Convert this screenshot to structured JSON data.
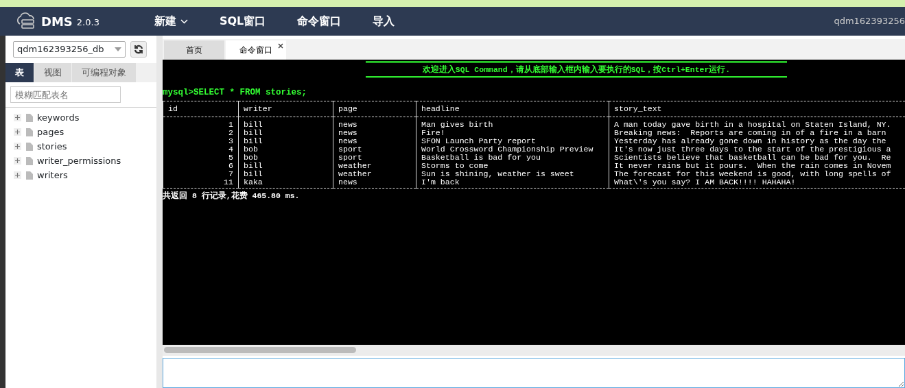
{
  "navbar": {
    "logo": "DMS",
    "version": "2.0.3",
    "menu": [
      {
        "label": "新建",
        "dropdown": true
      },
      {
        "label": "SQL窗口",
        "dropdown": false
      },
      {
        "label": "命令窗口",
        "dropdown": false
      },
      {
        "label": "导入",
        "dropdown": false
      }
    ],
    "user": "qdm162393256"
  },
  "sidebar": {
    "database": "qdm162393256_db",
    "tabs": [
      {
        "label": "表",
        "selected": true
      },
      {
        "label": "视图",
        "selected": false
      },
      {
        "label": "可编程对象",
        "selected": false
      }
    ],
    "search": {
      "placeholder": "模糊匹配表名"
    },
    "tables": [
      {
        "name": "keywords",
        "expanded": false
      },
      {
        "name": "pages",
        "expanded": false
      },
      {
        "name": "stories",
        "expanded": false
      },
      {
        "name": "writer_permissions",
        "expanded": false
      },
      {
        "name": "writers",
        "expanded": false
      }
    ]
  },
  "editor_tabs": [
    {
      "label": "首页",
      "selected": false,
      "closable": false
    },
    {
      "label": "命令窗口",
      "selected": true,
      "closable": true
    }
  ],
  "console": {
    "banner": "欢迎进入SQL Command，请从底部输入框内输入要执行的SQL，按Ctrl+Enter运行.",
    "command": "mysql>SELECT * FROM stories;",
    "table": {
      "columns": [
        "id",
        "writer",
        "page",
        "headline",
        "story_text"
      ],
      "rows": [
        [
          "1",
          "bill",
          "news",
          "Man gives birth",
          "A man today gave birth in a hospital on Staten Island, NY."
        ],
        [
          "2",
          "bill",
          "news",
          "Fire!",
          "Breaking news:  Reports are coming in of a fire in a barn"
        ],
        [
          "3",
          "bill",
          "news",
          "SFON Launch Party report",
          "Yesterday has already gone down in history as the day the"
        ],
        [
          "4",
          "bob",
          "sport",
          "World Crossword Championship Preview",
          "It's now just three days to the start of the prestigious a"
        ],
        [
          "5",
          "bob",
          "sport",
          "Basketball is bad for you",
          "Scientists believe that basketball can be bad for you.  Re"
        ],
        [
          "6",
          "bill",
          "weather",
          "Storms to come",
          "It never rains but it pours.  When the rain comes in Novem"
        ],
        [
          "7",
          "bill",
          "weather",
          "Sun is shining, weather is sweet",
          "The forecast for this weekend is good, with long spells of"
        ],
        [
          "11",
          "kaka",
          "news",
          "I'm back",
          "What\\'s you say? I AM BACK!!!! HAHAHA!"
        ]
      ]
    },
    "summary": "共返回 8 行记录,花费 465.80 ms."
  }
}
